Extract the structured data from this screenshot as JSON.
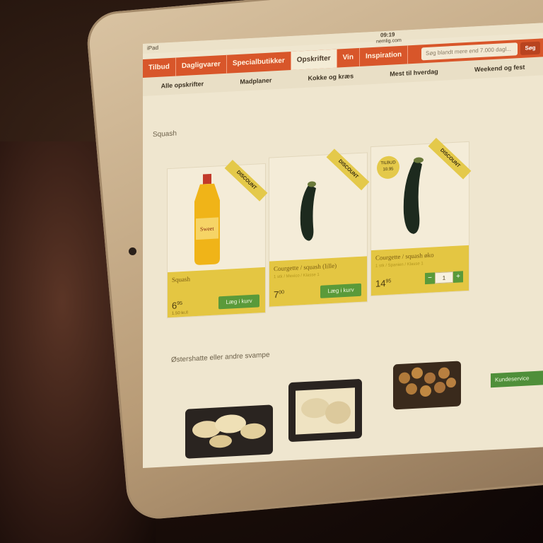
{
  "status_bar": {
    "device": "iPad",
    "time": "09:19",
    "url": "nemlig.com"
  },
  "nav": {
    "tabs": [
      "Tilbud",
      "Dagligvarer",
      "Specialbutikker",
      "Opskrifter",
      "Vin",
      "Inspiration"
    ],
    "active_tab": "Opskrifter",
    "search_placeholder": "Søg blandt mere end 7.000 dagl...",
    "search_button": "Søg"
  },
  "subnav": [
    "Alle opskrifter",
    "Madplaner",
    "Kokke og kræs",
    "Mest til hverdag",
    "Weekend og fest"
  ],
  "sections": {
    "first": "Squash",
    "second": "Østershatte eller andre svampe"
  },
  "badges": {
    "discount": "DISCOUNT",
    "tilbud_label": "TILBUD",
    "tilbud_price": "10.95"
  },
  "products": [
    {
      "name": "Squash",
      "price_int": "6",
      "price_dec": "95",
      "unit_price": "1.50 kr./l",
      "action": "Læg i kurv"
    },
    {
      "name": "Courgette / squash (lille)",
      "sub": "1 stk / Mexico / Klasse 1",
      "price_int": "7",
      "price_dec": "00",
      "action": "Læg i kurv"
    },
    {
      "name": "Courgette / squash øko",
      "sub": "1 stk / Spanien / Klasse 1",
      "price_int": "14",
      "price_dec": "95",
      "qty": "1"
    }
  ],
  "bottom_tab": "Kundeservice",
  "colors": {
    "nav": "#d8562a",
    "card_info": "#e4c642",
    "buy": "#5a9a3a"
  }
}
